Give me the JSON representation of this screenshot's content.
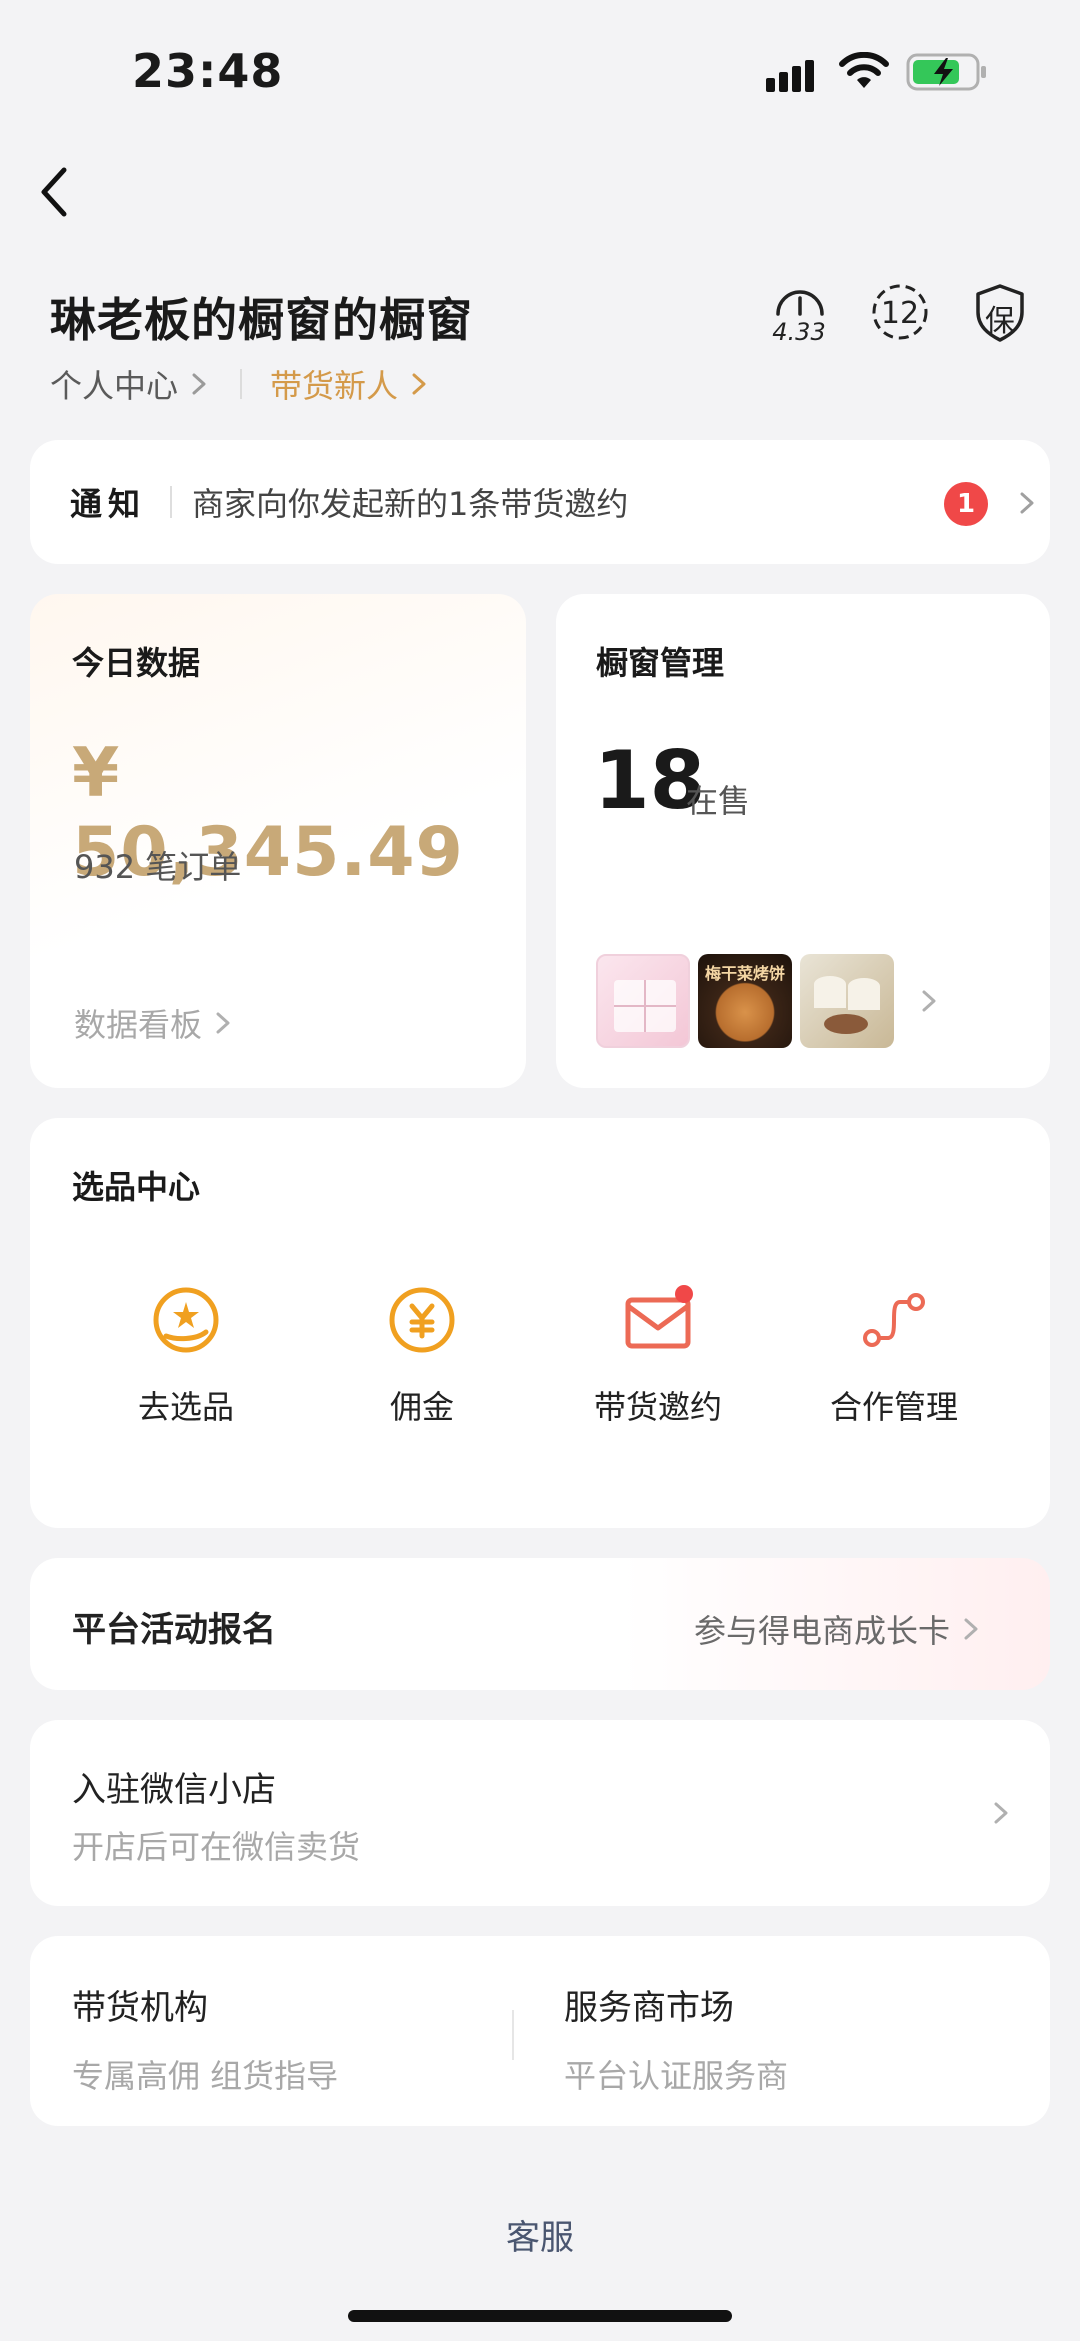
{
  "status_bar": {
    "time": "23:48"
  },
  "header": {
    "title": "琳老板的橱窗的橱窗",
    "score": "4.33",
    "level": "12",
    "guarantee": "保",
    "personal_center": "个人中心",
    "newbie_tag": "带货新人"
  },
  "notice": {
    "label": "通知",
    "text": "商家向你发起新的1条带货邀约",
    "badge": "1"
  },
  "today": {
    "heading": "今日数据",
    "amount": "¥ 50,345.49",
    "orders": "932 笔订单",
    "board_link": "数据看板"
  },
  "shelf": {
    "heading": "橱窗管理",
    "count": "18",
    "count_label": "在售",
    "thumb_label": "梅干菜烤饼"
  },
  "selection": {
    "heading": "选品中心",
    "items": [
      {
        "label": "去选品",
        "icon": "select-product-icon"
      },
      {
        "label": "佣金",
        "icon": "commission-icon"
      },
      {
        "label": "带货邀约",
        "icon": "invitation-icon"
      },
      {
        "label": "合作管理",
        "icon": "cooperation-icon"
      }
    ]
  },
  "activity": {
    "title": "平台活动报名",
    "right_text": "参与得电商成长卡"
  },
  "wechat_shop": {
    "title": "入驻微信小店",
    "subtitle": "开店后可在微信卖货"
  },
  "agency": {
    "left_title": "带货机构",
    "left_sub": "专属高佣 组货指导",
    "right_title": "服务商市场",
    "right_sub": "平台认证服务商"
  },
  "footer": {
    "service": "客服"
  },
  "colors": {
    "accent_gold": "#c8a978",
    "accent_orange": "#f0a020",
    "badge_red": "#f04848",
    "icon_coral": "#ec6a55"
  }
}
